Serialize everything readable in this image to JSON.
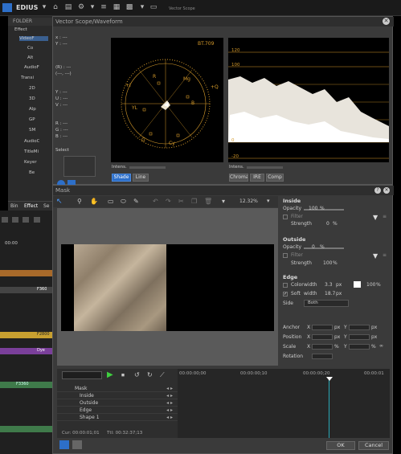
{
  "app": {
    "title": "EDIUS"
  },
  "left_panel": {
    "folder_label": "FOLDER",
    "tree": [
      "Effect",
      "VideoF",
      "Co",
      "Alt",
      "AudioF",
      "Transi",
      "2D",
      "3D",
      "Alp",
      "GP",
      "SM",
      "AudioC",
      "TitleMi",
      "Keyer",
      "Be"
    ],
    "bottom_tabs": [
      "Bin",
      "Effect",
      "Se"
    ]
  },
  "scope_window": {
    "title": "Vector Scope/Waveform",
    "titlebar_hint": "Vector Scope",
    "bt_label": "BT.709",
    "vector_labels": [
      "R",
      "Mg",
      "+Q",
      "B",
      "YL",
      "+I",
      "G",
      "Cy"
    ],
    "waveform_labels": [
      "120",
      "100",
      "0",
      "-20"
    ],
    "info_lines": [
      "x : ---",
      "Y : ---",
      "(R) : ---",
      "(---, ---)",
      "Y : ---",
      "U : ---",
      "V : ---",
      "R : ---",
      "G : ---",
      "B : ---"
    ],
    "select_label": "Select",
    "intens_label": "Intens.",
    "intens_label2": "Intens.",
    "buttons_left": [
      "Shade",
      "Line"
    ],
    "buttons_right": [
      "Chroma",
      "IRE",
      "Comp"
    ]
  },
  "mask_window": {
    "title": "Mask",
    "zoom": "12.32%",
    "inside": {
      "label": "Inside",
      "opacity_label": "Opacity",
      "opacity_value": "100",
      "opacity_unit": "%",
      "filter_label": "Filter",
      "strength_label": "Strength",
      "strength_value": "0",
      "strength_unit": "%"
    },
    "outside": {
      "label": "Outside",
      "opacity_label": "Opacity",
      "opacity_value": "0",
      "opacity_unit": "%",
      "filter_label": "Filter",
      "strength_label": "Strength",
      "strength_value": "100",
      "strength_unit": "%"
    },
    "edge": {
      "label": "Edge",
      "color_label": "Color",
      "width_label": "width",
      "color_width": "3.3",
      "color_unit": "px",
      "color_pct": "100",
      "pct_unit": "%",
      "soft_label": "Soft",
      "soft_width": "18.7",
      "soft_unit": "px",
      "side_label": "Side",
      "side_value": "Both"
    },
    "transform": {
      "anchor": "Anchor",
      "position": "Position",
      "scale": "Scale",
      "rotation": "Rotation",
      "x": "X",
      "y": "Y",
      "px": "px",
      "pct": "%"
    },
    "timeline": {
      "ruler": [
        "00:00:00;00",
        "00:00:00;10",
        "00:00:00;20",
        "00:00:01"
      ],
      "rows": [
        "Mask",
        "Inside",
        "Outside",
        "Edge",
        "Shape 1"
      ],
      "cur": "Cur: 00:00:01;01",
      "ttl": "Ttl: 00:32:37;13"
    },
    "ok_label": "OK",
    "cancel_label": "Cancel"
  },
  "left_tracks": {
    "labels": [
      "00:00",
      "F360",
      "F360",
      "F2800",
      "F2800",
      "Dye",
      "F3360"
    ]
  },
  "colors": {
    "accent_blue": "#2d6fc9",
    "scope_orange": "#d59a2a",
    "clip_yellow": "#c8a030",
    "clip_purple": "#7a3f9a",
    "clip_green": "#3f7a4a",
    "playhead": "#2aa8b8"
  }
}
